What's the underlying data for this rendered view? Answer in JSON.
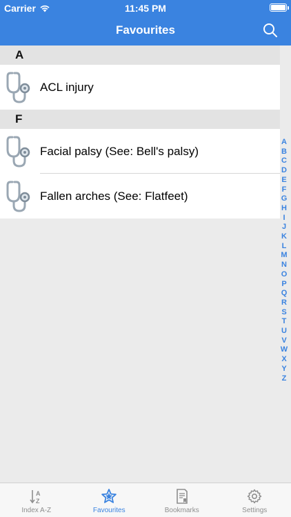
{
  "status_bar": {
    "carrier": "Carrier",
    "time": "11:45 PM"
  },
  "nav": {
    "title": "Favourites"
  },
  "sections": [
    {
      "header": "A",
      "rows": [
        {
          "label": "ACL injury"
        }
      ]
    },
    {
      "header": "F",
      "rows": [
        {
          "label": "Facial palsy (See: Bell's palsy)"
        },
        {
          "label": "Fallen arches (See: Flatfeet)"
        }
      ]
    }
  ],
  "index_letters": [
    "A",
    "B",
    "C",
    "D",
    "E",
    "F",
    "G",
    "H",
    "I",
    "J",
    "K",
    "L",
    "M",
    "N",
    "O",
    "P",
    "Q",
    "R",
    "S",
    "T",
    "U",
    "V",
    "W",
    "X",
    "Y",
    "Z"
  ],
  "tabs": [
    {
      "label": "Index A-Z",
      "icon": "sort-az-icon",
      "active": false
    },
    {
      "label": "Favourites",
      "icon": "star-icon",
      "active": true
    },
    {
      "label": "Bookmarks",
      "icon": "bookmark-doc-icon",
      "active": false
    },
    {
      "label": "Settings",
      "icon": "gear-icon",
      "active": false
    }
  ],
  "colors": {
    "accent": "#3a83e0",
    "section_bg": "#e3e3e3",
    "background": "#ebebeb"
  }
}
